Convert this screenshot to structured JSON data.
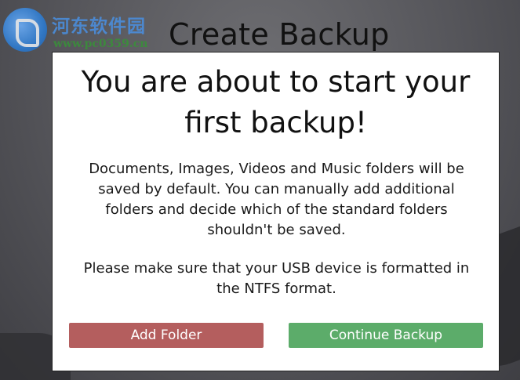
{
  "window": {
    "title": "Create Backup"
  },
  "watermark": {
    "name": "河东软件园",
    "url": "www.pc0359.cn"
  },
  "dialog": {
    "heading_lines": [
      "You are about to start your",
      "first backup!"
    ],
    "paragraph1_lines": [
      "Documents, Images, Videos and Music folders will be",
      "saved by default. You can manually add additional",
      "folders and decide which of the standard folders",
      "shouldn't be saved."
    ],
    "paragraph2_lines": [
      "Please make sure that your USB device is formatted in",
      "the NTFS format."
    ],
    "buttons": {
      "add_folder": "Add Folder",
      "continue_backup": "Continue Backup"
    }
  },
  "colors": {
    "add_folder_button": "#b45e5e",
    "continue_button": "#5cac6a",
    "dialog_background": "#ffffff",
    "backdrop": "#5d5d60"
  }
}
